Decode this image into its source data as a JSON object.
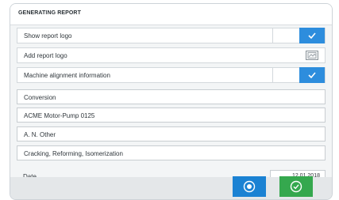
{
  "header": {
    "title": "GENERATING REPORT"
  },
  "options": [
    {
      "label": "Show report logo",
      "control": "toggle",
      "state": "on"
    },
    {
      "label": "Add report logo",
      "control": "image-button",
      "icon": "image-icon"
    },
    {
      "label": "Machine alignment information",
      "control": "toggle",
      "state": "on"
    }
  ],
  "fields": [
    {
      "value": "Conversion"
    },
    {
      "value": "ACME Motor-Pump 0125"
    },
    {
      "value": "A. N. Other"
    },
    {
      "value": "Cracking, Reforming, Isomerization"
    }
  ],
  "partial_row": {
    "label": "Date",
    "value": "12.01.2018"
  },
  "footer": {
    "preview_icon": "preview-icon",
    "confirm_icon": "check-circle-icon"
  },
  "colors": {
    "toggle_on": "#2d8ddd",
    "preview": "#1b82d3",
    "confirm": "#35a84e"
  }
}
